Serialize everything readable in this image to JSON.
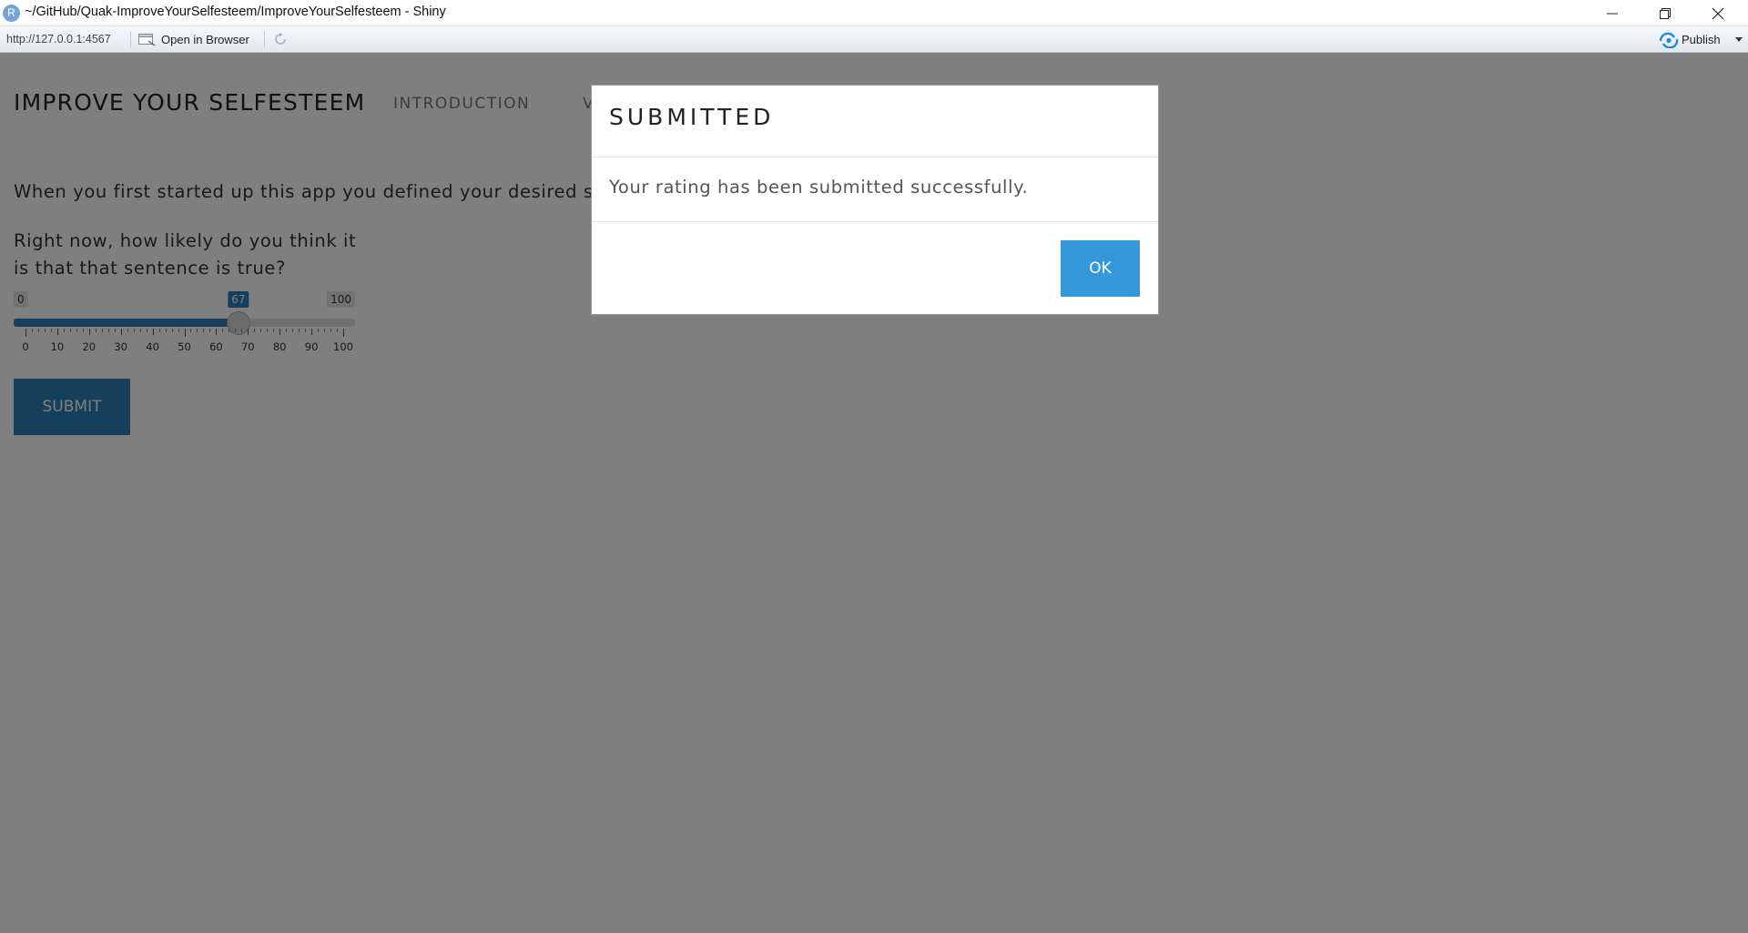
{
  "window": {
    "app_icon_letter": "R",
    "title": "~/GitHub/Quak-ImproveYourSelfesteem/ImproveYourSelfesteem - Shiny"
  },
  "toolbar": {
    "url": "http://127.0.0.1:4567",
    "open_in_browser_label": "Open in Browser",
    "publish_label": "Publish",
    "accent_color": "#1a8fd1"
  },
  "app": {
    "brand": "IMPROVE YOUR SELFESTEEM",
    "nav_items": [
      "INTRODUCTION",
      "V"
    ],
    "intro_text": "When you first started up this app you defined your desired se",
    "question": "Right now, how likely do you think it is that that sentence is true?",
    "slider": {
      "min": 0,
      "max": 100,
      "value": 67,
      "min_label": "0",
      "max_label": "100",
      "value_label": "67",
      "tick_labels": [
        "0",
        "10",
        "20",
        "30",
        "40",
        "50",
        "60",
        "70",
        "80",
        "90",
        "100"
      ],
      "color": "#2c7fb8"
    },
    "submit_label": "SUBMIT"
  },
  "modal": {
    "title": "SUBMITTED",
    "message": "Your rating has been submitted successfully.",
    "ok_label": "OK",
    "ok_color": "#3498db"
  }
}
